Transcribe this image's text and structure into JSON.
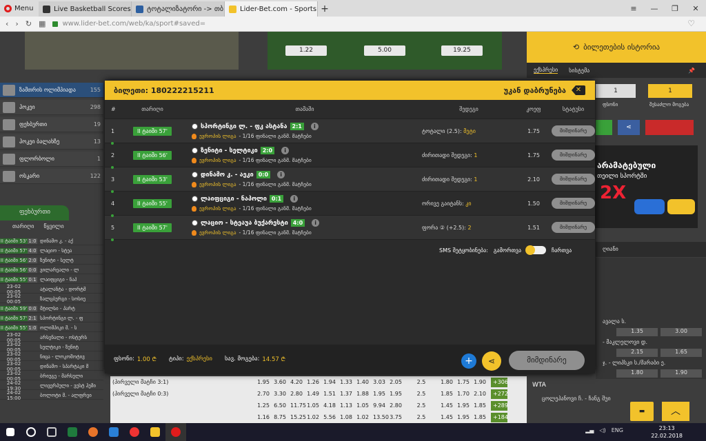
{
  "browser": {
    "menu_label": "Menu",
    "tabs": [
      {
        "label": "Live Basketball Scores - NB",
        "active": false
      },
      {
        "label": "ტოტალიზატორი -> თბ",
        "active": false
      },
      {
        "label": "Lider-Bet.com - Sports and",
        "active": true
      }
    ],
    "url": "www.lider-bet.com/web/ka/sport#saved="
  },
  "background": {
    "odds": [
      "1.22",
      "5.00",
      "19.25"
    ],
    "history_button": "ბილეთების ისტორია",
    "subtabs": [
      "ექსპრესი",
      "სისტემა"
    ],
    "stake_boxes": [
      "1",
      "1"
    ],
    "stake_labels": [
      "ფსონი",
      "შესაძლო მოგება"
    ],
    "sidebar": [
      {
        "label": "ზამთრის ოლიმპიადა",
        "count": "155"
      },
      {
        "label": "ჰოკეი",
        "count": "298"
      },
      {
        "label": "ფეხბურთი",
        "count": "19"
      },
      {
        "label": "ჰოკეი ბალახზე",
        "count": "13"
      },
      {
        "label": "ფლორბოლი",
        "count": "1"
      },
      {
        "label": "ოსკარი",
        "count": "122"
      }
    ],
    "sport_tab": "ფეხბურთი",
    "list_header": [
      "თარიღი",
      "წყვილი"
    ],
    "list_rows": [
      {
        "t": "II ტაიმი 53'",
        "s": "1:0",
        "n": "დინამო კ. - აქ"
      },
      {
        "t": "II ტაიმი 57'",
        "s": "4:0",
        "n": "ლაციო - სტეა"
      },
      {
        "t": "II ტაიმი 56'",
        "s": "2:0",
        "n": "ზენიტი - სელტ"
      },
      {
        "t": "II ტაიმი 56'",
        "s": "0:0",
        "n": "ვილარეალი - ლ"
      },
      {
        "t": "II ტაიმი 55'",
        "s": "0:1",
        "n": "ლაიფციგი - ნაპ"
      },
      {
        "t": "23-02 00:05",
        "s": "",
        "n": "ატალანტა - დორტმ"
      },
      {
        "t": "23-02 00:05",
        "s": "",
        "n": "ზალცბურგი - სოსიე"
      },
      {
        "t": "II ტაიმი 59'",
        "s": "0:0",
        "n": "მტილსი - პარტ"
      },
      {
        "t": "II ტაიმი 57'",
        "s": "2:1",
        "n": "სპორტინგი ლ. - ფ"
      },
      {
        "t": "II ტაიმი 55'",
        "s": "1:0",
        "n": "ოლიმპიკი მ. - ს"
      },
      {
        "t": "23-02 00:05",
        "s": "",
        "n": "არსენალი - ოსტერს"
      },
      {
        "t": "23-02 00:05",
        "s": "",
        "n": "სელტიკი - ზენიტ"
      },
      {
        "t": "23-02 00:05",
        "s": "",
        "n": "ნიცა - ლოკომოტივ"
      },
      {
        "t": "23-02 00:05",
        "s": "",
        "n": "დინამო - სპარტაკი მ"
      },
      {
        "t": "23-02 00:05",
        "s": "",
        "n": "ბრიუგე - მარსელი"
      },
      {
        "t": "24-02 19:30",
        "s": "",
        "n": "ლივერპული - ვესტ ჰემი"
      },
      {
        "t": "24-02 15:00",
        "s": "",
        "n": "ბოლოტი მ. - ალფრეი"
      }
    ],
    "bottom_rows": [
      {
        "label": "(პირველი მატჩი 3:1)",
        "v": [
          "1.95",
          "3.60",
          "4.20",
          "1.26",
          "1.94",
          "1.33",
          "1.40",
          "3.03",
          "2.05",
          "2.5",
          "1.80",
          "1.75",
          "1.90"
        ],
        "plus": "+306"
      },
      {
        "label": "(პირველი მატჩი 0:3)",
        "v": [
          "2.70",
          "3.30",
          "2.80",
          "1.49",
          "1.51",
          "1.37",
          "1.88",
          "1.95",
          "1.95",
          "2.5",
          "1.85",
          "1.70",
          "2.10"
        ],
        "plus": "+272"
      },
      {
        "label": "",
        "v": [
          "1.25",
          "6.50",
          "11.75",
          "1.05",
          "4.18",
          "1.13",
          "1.05",
          "9.94",
          "2.80",
          "2.5",
          "1.45",
          "1.95",
          "1.85"
        ],
        "plus": "+289"
      },
      {
        "label": "",
        "v": [
          "1.16",
          "8.75",
          "15.25",
          "1.02",
          "5.56",
          "1.08",
          "1.02",
          "13.50",
          "3.75",
          "2.5",
          "1.45",
          "1.95",
          "1.85"
        ],
        "plus": "+184"
      }
    ],
    "right_panel": {
      "promo_title": "არამატებული",
      "promo_sub": "თეილი სპორტში",
      "promo_mult": "2X",
      "tab_label": "ღიანი",
      "matches": [
        {
          "name": "ავალა ს.",
          "odds": [
            "1.35",
            "3.00"
          ]
        },
        {
          "name": "- მაკლელოვი დ.",
          "odds": [
            "2.15",
            "1.65"
          ]
        },
        {
          "name": "ჯ. - ლიპსკი ს./შარაბი ე.",
          "odds": [
            "1.80",
            "1.90"
          ]
        }
      ],
      "wta_label": "WTA",
      "wta_match": "ცოლეპანოვი ჩ. - ჩანგ შუი"
    }
  },
  "modal": {
    "title": "ბილეთი: 180222215211",
    "back_label": "უკან დაბრუნება",
    "columns": [
      "#",
      "თარიღი",
      "თამაში",
      "შედეგი",
      "კოეფ",
      "სტატუსი"
    ],
    "rows": [
      {
        "n": "1",
        "time": "II ტაიმი 57'",
        "match": "სპორტინგი ლ. - ფკ ასტანა",
        "score": "2:1",
        "league": "ევროპის ლიგა",
        "league_sub": "- 1/16 ფინალი განმ. მატჩები",
        "result_label": "ტოტალი (2.5): ",
        "result_value": "მეტი",
        "odd": "1.75",
        "status": "მიმდინარე"
      },
      {
        "n": "2",
        "time": "II ტაიმი 56'",
        "match": "ზენიტი - სელტიკი",
        "score": "2:0",
        "league": "ევროპის ლიგა",
        "league_sub": "- 1/16 ფინალი განმ. მატჩები",
        "result_label": "ძირითადი შედეგი: ",
        "result_value": "1",
        "odd": "1.75",
        "status": "მიმდინარე"
      },
      {
        "n": "3",
        "time": "II ტაიმი 53'",
        "match": "დინამო კ. - აეკი",
        "score": "0:0",
        "league": "ევროპის ლიგა",
        "league_sub": "- 1/16 ფინალი განმ. მატჩები",
        "result_label": "ძირითადი შედეგი: ",
        "result_value": "1",
        "odd": "2.10",
        "status": "მიმდინარე"
      },
      {
        "n": "4",
        "time": "II ტაიმი 55'",
        "match": "ლაიფციგი - ნაპოლი",
        "score": "0:1",
        "league": "ევროპის ლიგა",
        "league_sub": "- 1/16 ფინალი განმ. მატჩები",
        "result_label": "ორივე გაიტანს: ",
        "result_value": "კი",
        "odd": "1.50",
        "status": "მიმდინარე"
      },
      {
        "n": "5",
        "time": "II ტაიმი 57'",
        "match": "ლაციო - სტეაუა ბუქარესტი",
        "score": "4:0",
        "league": "ევროპის ლიგა",
        "league_sub": "- 1/16 ფინალი განმ. მატჩები",
        "result_label": "ფორა ② (+2.5): ",
        "result_value": "2",
        "odd": "1.51",
        "status": "მიმდინარე"
      }
    ],
    "sms_label": "SMS შეტყობინება:",
    "sms_on": "გამორთვა",
    "sms_off": "ჩართვა",
    "footer": {
      "stake_label": "ფსონი:",
      "stake_value": "1.00 ₾",
      "type_label": "ტიპი:",
      "type_value": "ექსპრესი",
      "win_label": "სავ. მოგება:",
      "win_value": "14.57 ₾"
    },
    "status_button": "მიმდინარე"
  },
  "taskbar": {
    "lang": "ENG",
    "time": "23:13",
    "date": "22.02.2018"
  },
  "colors": {
    "accent": "#f2c22b",
    "live": "#3aa13a",
    "dark": "#2b2b2b"
  }
}
